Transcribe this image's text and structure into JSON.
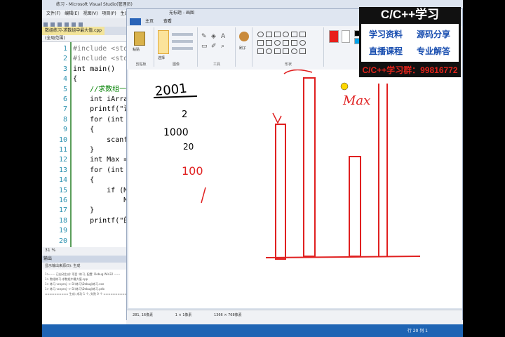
{
  "vs": {
    "title": "练习 - Microsoft Visual Studio(管理员)",
    "menu": [
      "文件(F)",
      "编辑(E)",
      "视图(V)",
      "项目(P)",
      "生成(B)"
    ],
    "active_tab": "数组练习-求数组中最大值.cpp",
    "scope": "(全局范围)",
    "code_lines": [
      {
        "n": "1",
        "text": "#include <stdio.h>",
        "kind": "pp"
      },
      {
        "n": "2",
        "text": "#include <stdlib.h>",
        "kind": "pp"
      },
      {
        "n": "3",
        "text": "int main()",
        "kind": "kw"
      },
      {
        "n": "4",
        "text": "{",
        "kind": "plain"
      },
      {
        "n": "5",
        "text": "    //求数组一",
        "kind": "cm"
      },
      {
        "n": "6",
        "text": "    int iArra",
        "kind": "kw"
      },
      {
        "n": "7",
        "text": "    printf(\"请",
        "kind": "plain"
      },
      {
        "n": "8",
        "text": "    for (int",
        "kind": "kw"
      },
      {
        "n": "9",
        "text": "    {",
        "kind": "plain"
      },
      {
        "n": "10",
        "text": "        scanf",
        "kind": "plain"
      },
      {
        "n": "11",
        "text": "    }",
        "kind": "plain"
      },
      {
        "n": "12",
        "text": "    int Max =",
        "kind": "kw"
      },
      {
        "n": "13",
        "text": "    for (int",
        "kind": "kw"
      },
      {
        "n": "14",
        "text": "    {",
        "kind": "plain"
      },
      {
        "n": "15",
        "text": "        if (M",
        "kind": "kw"
      },
      {
        "n": "16",
        "text": "            M",
        "kind": "plain"
      },
      {
        "n": "17",
        "text": "    }",
        "kind": "plain"
      },
      {
        "n": "18",
        "text": "    printf(\"的",
        "kind": "plain"
      },
      {
        "n": "19",
        "text": "",
        "kind": "plain"
      },
      {
        "n": "20",
        "text": "",
        "kind": "plain"
      }
    ],
    "zoom": "31 %",
    "output_title": "输出",
    "output_bar": "显示输出来源(S): 生成",
    "output_lines": [
      "1>------ 已启动生成: 项目: 练习, 配置: Debug Win32 ------",
      "1> 数组练习-求数组中最大值.cpp",
      "1> 练习.vcxproj -> D:\\练习\\Debug\\练习.exe",
      "1> 练习.vcxproj -> D:\\练习\\Debug\\练习.pdb",
      "========== 生成: 成功 1 个, 失败 0 个 =========="
    ],
    "status_right": "行 20   列 1"
  },
  "paint": {
    "title": "无标题 - 画图",
    "tabs": [
      "主页",
      "查看"
    ],
    "groups": [
      "剪贴板",
      "图像",
      "工具",
      "形状",
      "颜色"
    ],
    "tool_labels": [
      "粘贴",
      "选择",
      "刷子"
    ],
    "colors": [
      "#e8211c",
      "#000000",
      "#7f7f7f",
      "#880015",
      "#ed1c24",
      "#ff7f27",
      "#fff200",
      "#22b14c",
      "#00a2e8",
      "#3f48cc",
      "#a349a4",
      "#ffffff",
      "#c3c3c3",
      "#b97a57",
      "#ffaec9"
    ],
    "status_items": [
      "281, 16像素",
      "1 × 1像素",
      "1366 × 768像素"
    ]
  },
  "annotations": {
    "top_number": "2001",
    "num2": "2",
    "mid_number": "1000",
    "sub": "20",
    "red_number": "100",
    "max_label": "Max"
  },
  "banner": {
    "title": "C/C++学习",
    "items": [
      "学习资料",
      "源码分享",
      "直播课程",
      "专业解答"
    ],
    "qq_group": "C/C++学习群：99816772"
  }
}
